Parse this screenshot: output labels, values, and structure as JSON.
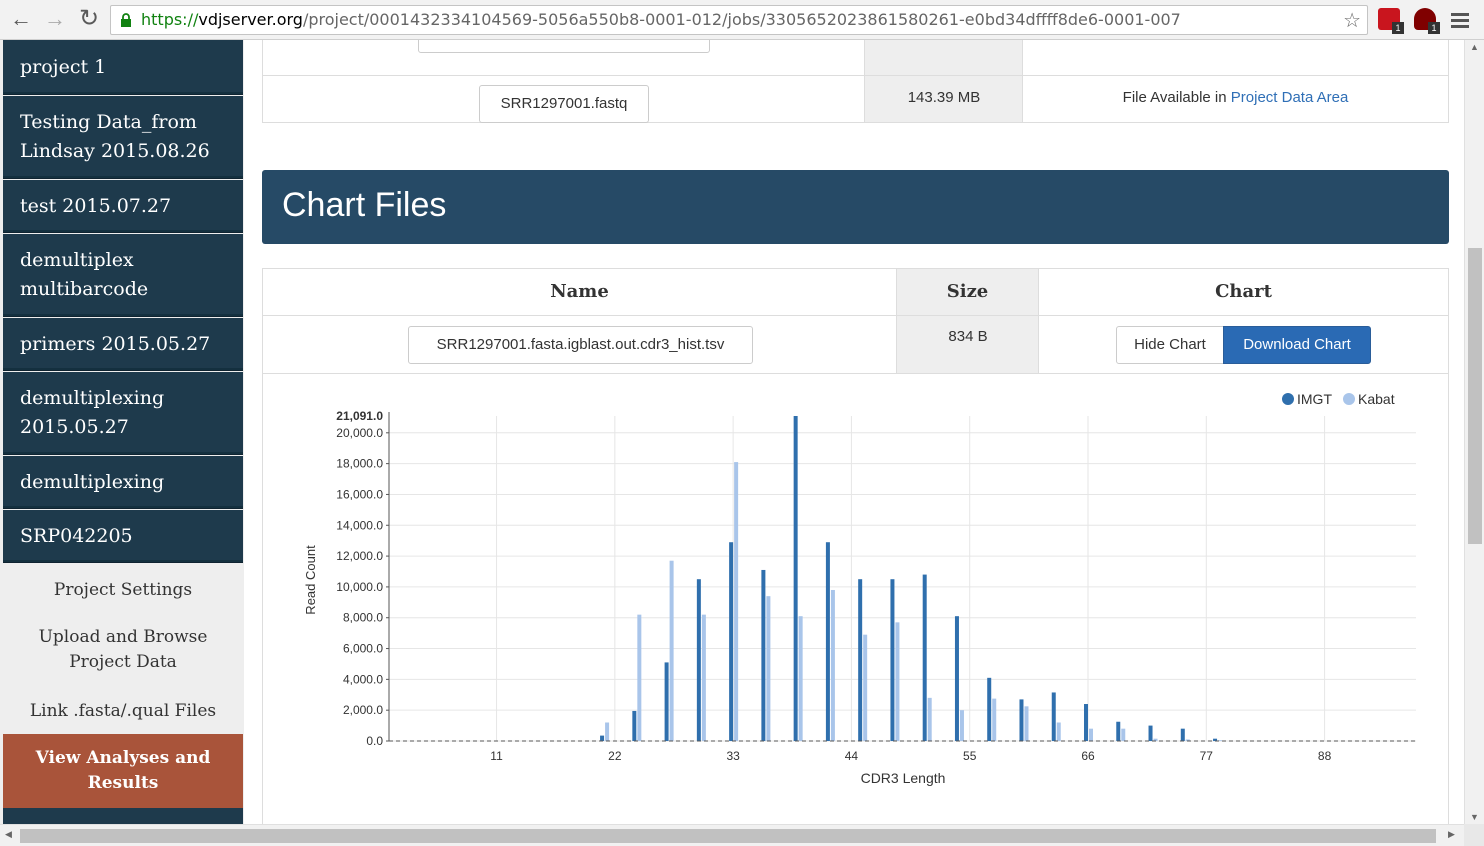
{
  "browser": {
    "url_scheme": "https://",
    "url_host": "vdjserver.org",
    "url_path": "/project/0001432334104569-5056a550b8-0001-012/jobs/3305652023861580261-e0bd34dffff8de6-0001-007",
    "ext1_badge": "1",
    "ext2_badge": "1"
  },
  "sidebar": {
    "projects": [
      {
        "label": "project 1"
      },
      {
        "label": "Testing Data_from Lindsay 2015.08.26"
      },
      {
        "label": "test 2015.07.27"
      },
      {
        "label": "demultiplex multibarcode"
      },
      {
        "label": "primers 2015.05.27"
      },
      {
        "label": "demultiplexing 2015.05.27"
      },
      {
        "label": "demultiplexing"
      },
      {
        "label": "SRP042205"
      }
    ],
    "nav": [
      {
        "label": "Project Settings"
      },
      {
        "label": "Upload and Browse Project Data"
      },
      {
        "label": "Link .fasta/.qual Files"
      },
      {
        "label": "View Analyses and Results"
      }
    ]
  },
  "top_table": {
    "file_button": "SRR1297001.fastq",
    "size": "143.39 MB",
    "status_prefix": "File Available in",
    "status_link": "Project Data Area"
  },
  "chart_section": {
    "title": "Chart Files",
    "headers": {
      "name": "Name",
      "size": "Size",
      "chart": "Chart"
    },
    "file_button": "SRR1297001.fasta.igblast.out.cdr3_hist.tsv",
    "size": "834 B",
    "hide_button": "Hide Chart",
    "download_button": "Download Chart"
  },
  "chart_data": {
    "type": "bar",
    "xlabel": "CDR3 Length",
    "ylabel": "Read Count",
    "ylim": [
      0,
      21091
    ],
    "y_max_label": "21,091.0",
    "y_ticks": [
      "0.0",
      "2,000.0",
      "4,000.0",
      "6,000.0",
      "8,000.0",
      "10,000.0",
      "12,000.0",
      "14,000.0",
      "16,000.0",
      "18,000.0",
      "20,000.0"
    ],
    "x_ticks": [
      "11",
      "22",
      "33",
      "44",
      "55",
      "66",
      "77",
      "88"
    ],
    "legend_position": "top-right",
    "series": [
      {
        "name": "IMGT",
        "color": "#2f6fad",
        "x": [
          21,
          24,
          27,
          30,
          33,
          36,
          39,
          42,
          45,
          48,
          51,
          54,
          57,
          60,
          63,
          66,
          69,
          72,
          75,
          78
        ],
        "values": [
          350,
          1950,
          5100,
          10500,
          12900,
          11100,
          21091,
          12900,
          10500,
          10500,
          10800,
          8100,
          4100,
          2700,
          3150,
          2400,
          1250,
          1000,
          800,
          150
        ]
      },
      {
        "name": "Kabat",
        "color": "#a9c5ea",
        "x": [
          21,
          24,
          27,
          30,
          33,
          36,
          39,
          42,
          45,
          48,
          51,
          54,
          57,
          60,
          63,
          66,
          69,
          72,
          75,
          78
        ],
        "values": [
          1200,
          8200,
          11700,
          8200,
          18100,
          9400,
          8100,
          9800,
          6900,
          7700,
          2800,
          2000,
          2750,
          2250,
          1200,
          800,
          800,
          150,
          100,
          50
        ]
      }
    ]
  }
}
